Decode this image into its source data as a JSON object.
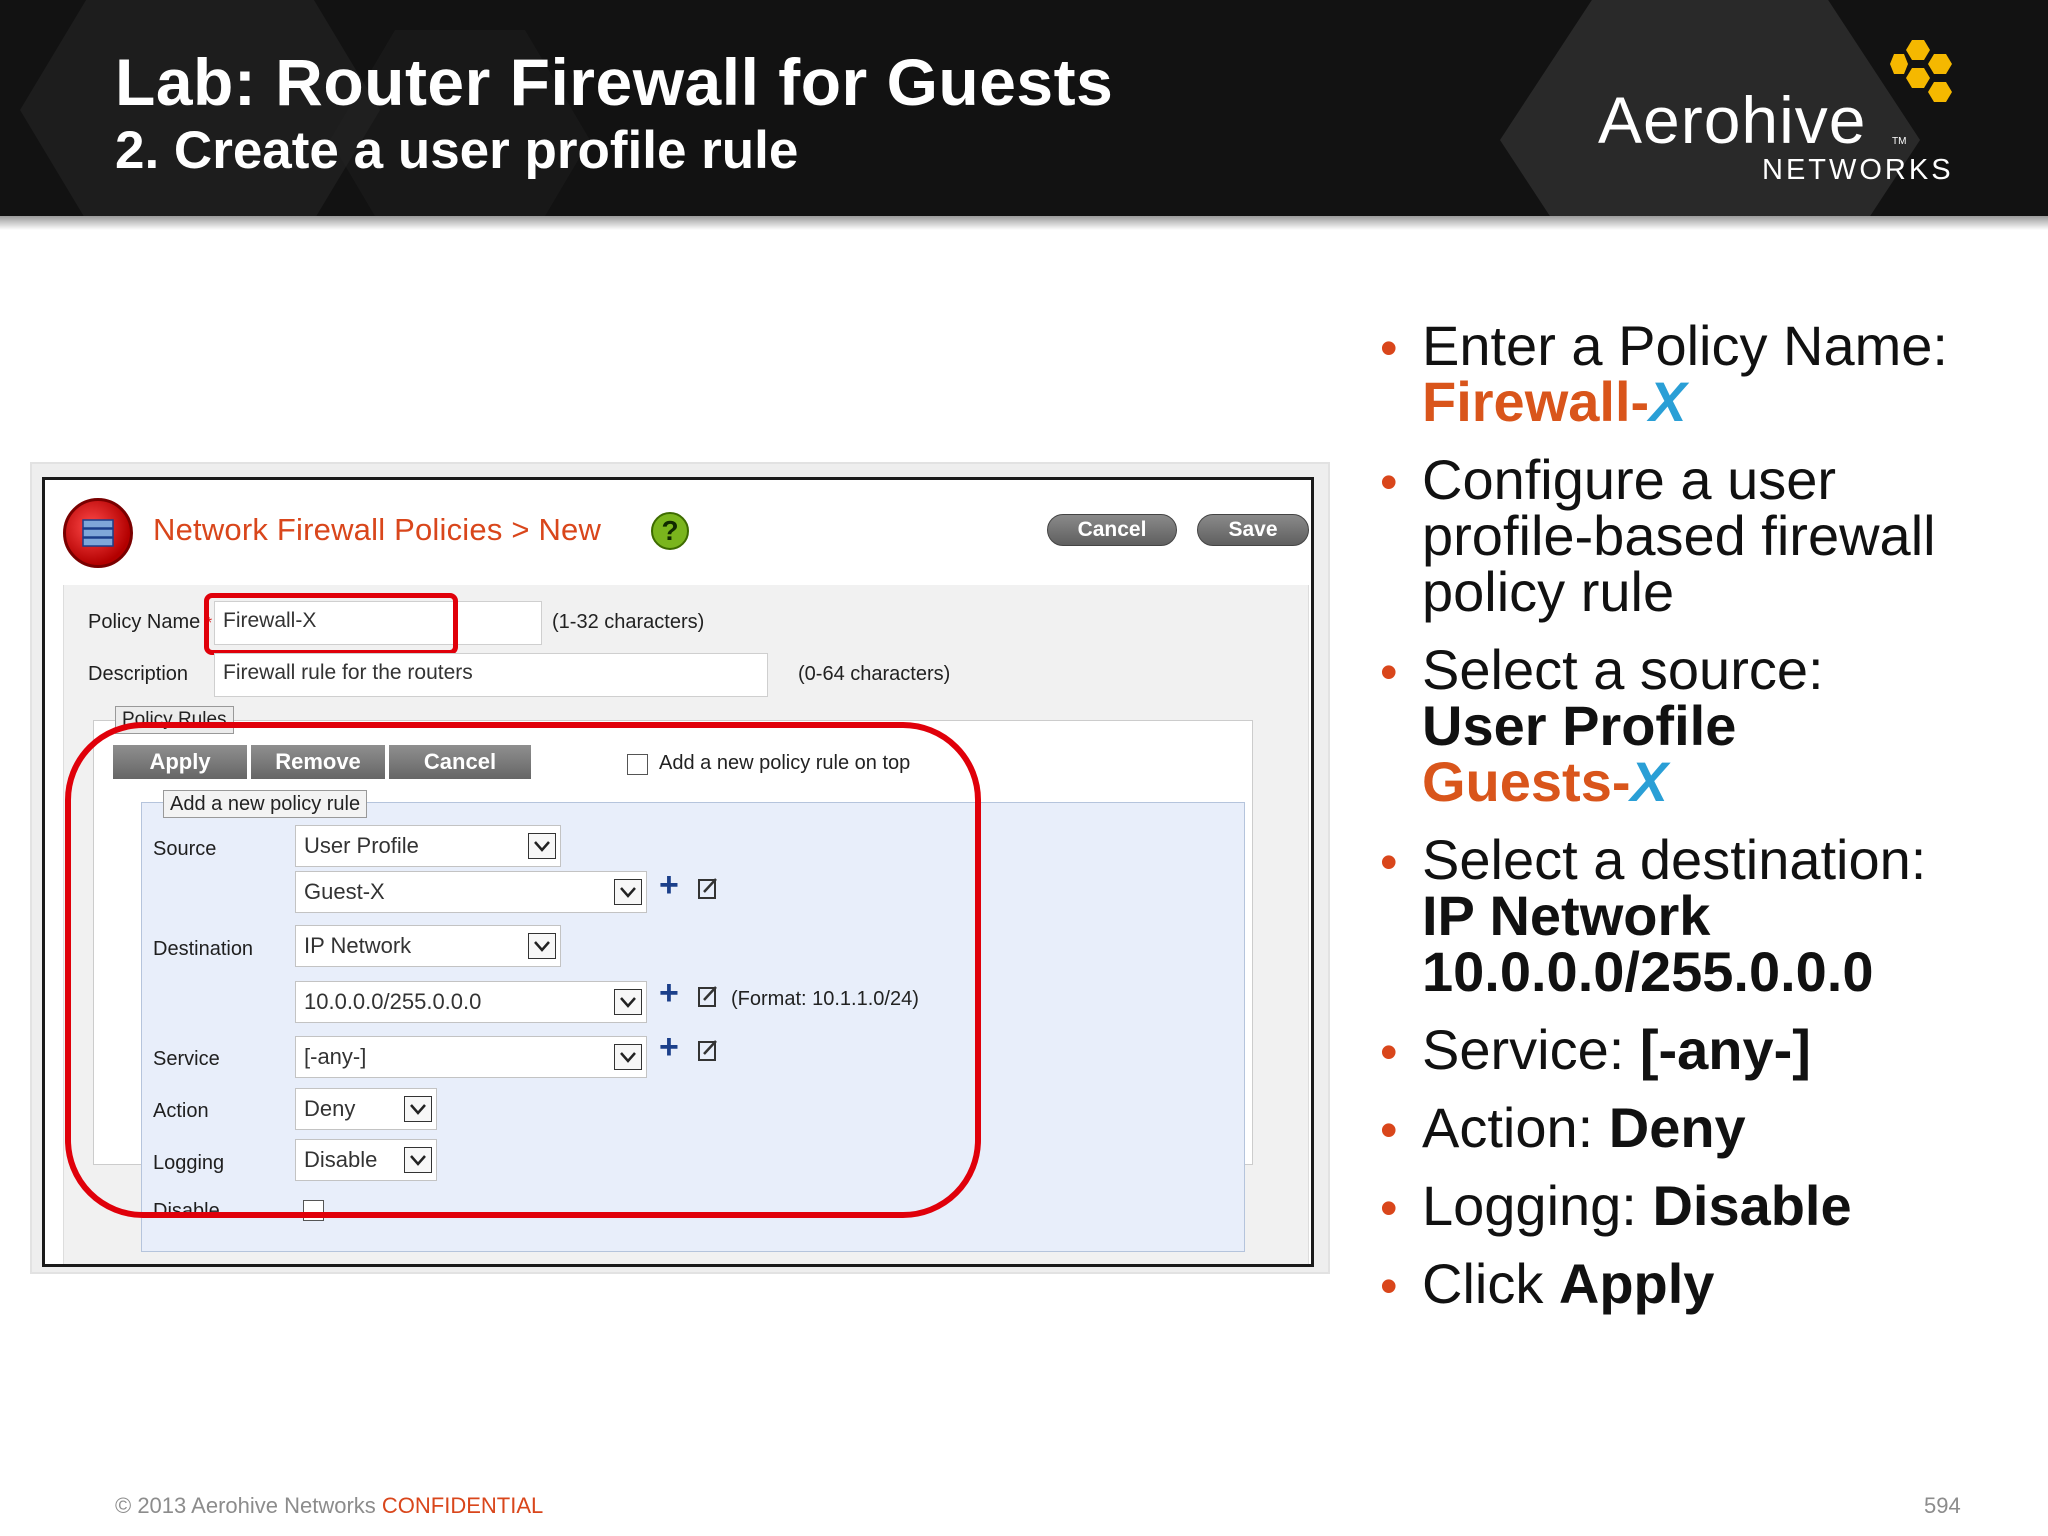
{
  "slide": {
    "title": "Lab: Router Firewall for Guests",
    "subtitle": "2. Create a user profile rule",
    "logo_word": "Aerohive",
    "logo_tm": "TM",
    "logo_sub": "NETWORKS",
    "footer_copyright": "© 2013 Aerohive Networks ",
    "footer_confidential": "CONFIDENTIAL",
    "page_number": "594",
    "accent_color": "#d9461b",
    "honeycomb_color": "#f5b800"
  },
  "app": {
    "breadcrumb": "Network Firewall Policies > New",
    "help_icon": "?",
    "cancel_label": "Cancel",
    "save_label": "Save",
    "policy_name_label": "Policy Name",
    "required_mark": "*",
    "policy_name_value": "Firewall-X",
    "policy_name_hint": "(1-32 characters)",
    "description_label": "Description",
    "description_value": "Firewall rule for the routers",
    "description_hint": "(0-64 characters)",
    "policy_rules_tab": "Policy Rules",
    "apply_label": "Apply",
    "remove_label": "Remove",
    "tool_cancel_label": "Cancel",
    "add_on_top_label": "Add a new policy rule on top",
    "add_rule_tab": "Add a new policy rule",
    "source_label": "Source",
    "source_type": "User Profile",
    "source_value": "Guest-X",
    "destination_label": "Destination",
    "destination_type": "IP Network",
    "destination_value": "10.0.0.0/255.0.0.0",
    "format_hint": "(Format: 10.1.1.0/24)",
    "service_label": "Service",
    "service_value": "[-any-]",
    "action_label": "Action",
    "action_value": "Deny",
    "logging_label": "Logging",
    "logging_value": "Disable",
    "disable_label": "Disable"
  },
  "bullets": [
    {
      "text": "Enter a Policy Name:",
      "highlight_prefix": "Firewall-",
      "highlight_x": "X"
    },
    {
      "text": "Configure a user profile-based firewall policy rule"
    },
    {
      "text": "Select a source:",
      "bold": "User Profile",
      "highlight_prefix": "Guests-",
      "highlight_x": "X"
    },
    {
      "text": "Select a destination:",
      "bold": "IP Network",
      "bold2": "10.0.0.0/255.0.0.0"
    },
    {
      "text": "Service: ",
      "bold": "[-any-]"
    },
    {
      "text": "Action: ",
      "bold": "Deny"
    },
    {
      "text": "Logging: ",
      "bold": "Disable"
    },
    {
      "text": "Click ",
      "bold": "Apply"
    }
  ]
}
